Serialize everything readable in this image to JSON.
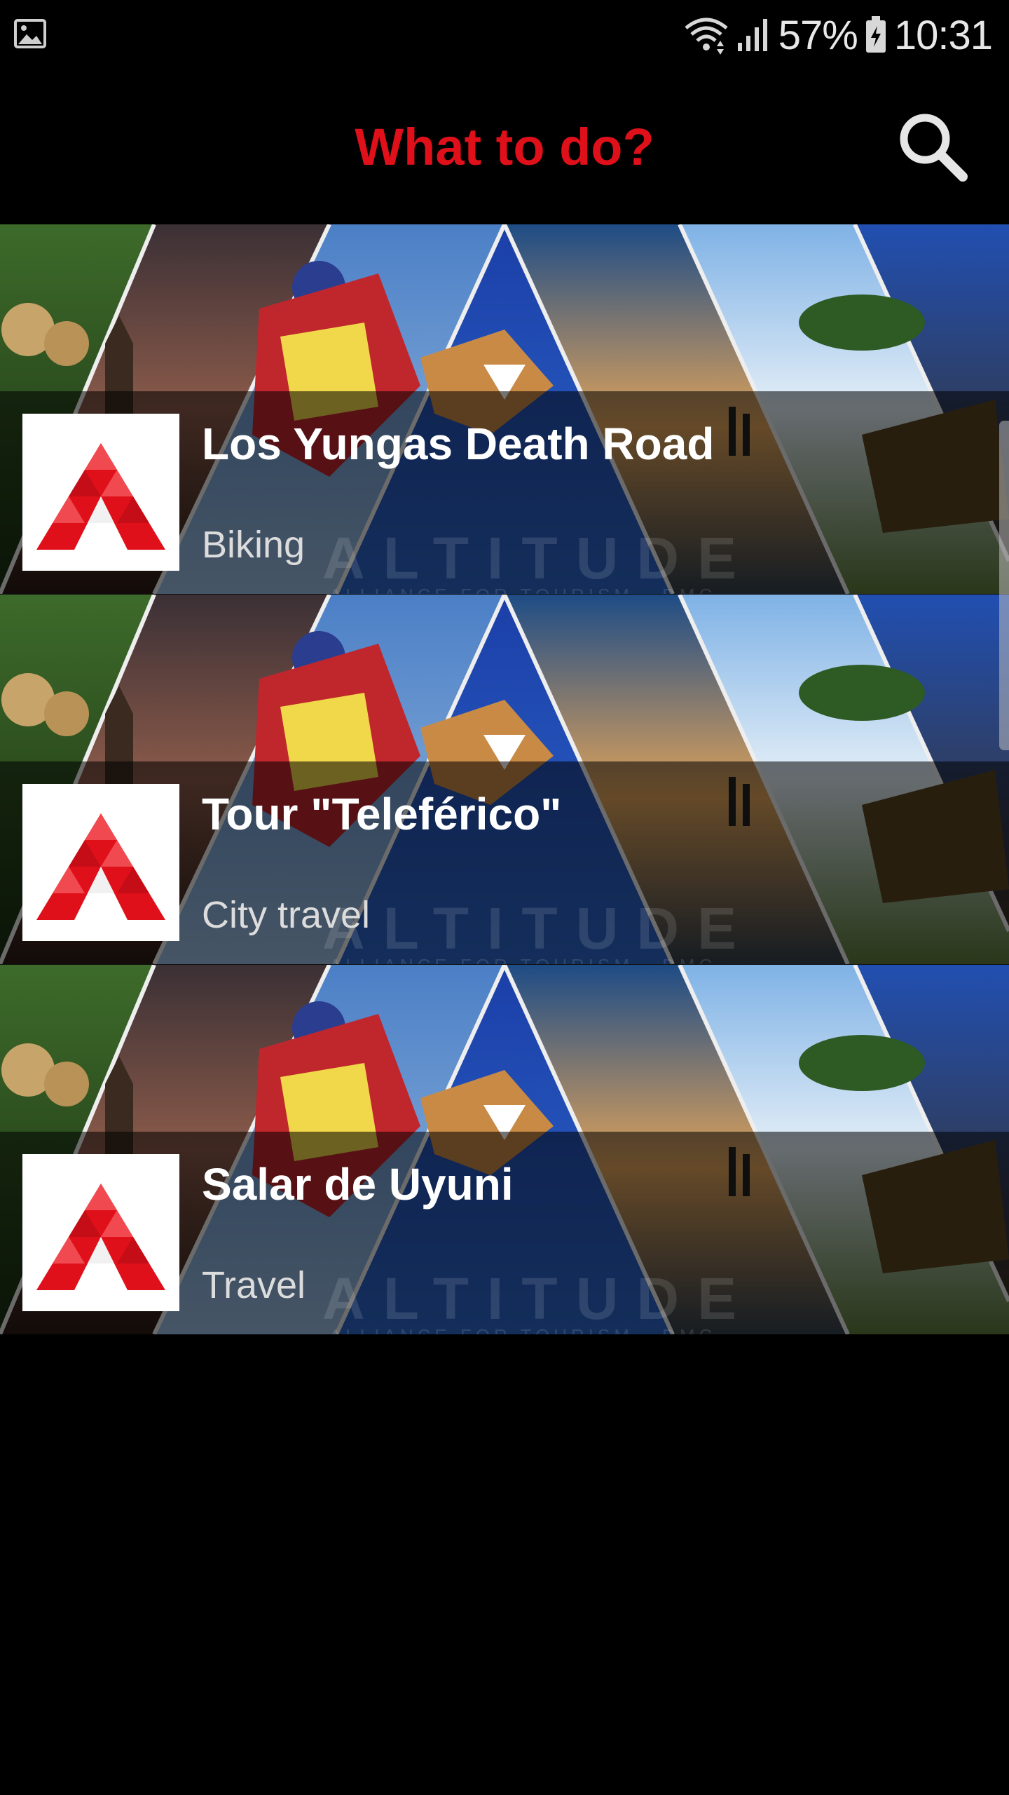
{
  "status_bar": {
    "battery": "57%",
    "time": "10:31",
    "icons": [
      "gallery-notification-icon",
      "wifi-icon",
      "signal-icon",
      "battery-icon"
    ]
  },
  "header": {
    "title": "What to do?",
    "search_icon": "search-icon"
  },
  "banner_watermark": {
    "brand": "ALTITUDE",
    "tagline": "ALLIANCE FOR TOURISM · DMC"
  },
  "activities": [
    {
      "title": "Los Yungas Death Road",
      "category": "Biking"
    },
    {
      "title": "Tour \"Teleférico\"",
      "category": "City travel"
    },
    {
      "title": "Salar de Uyuni",
      "category": "Travel"
    }
  ],
  "colors": {
    "accent": "#e0101a",
    "background": "#000000"
  }
}
